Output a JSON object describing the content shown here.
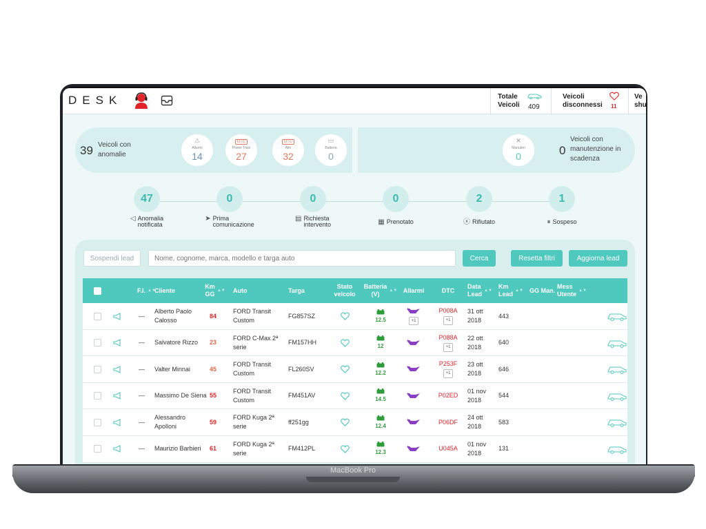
{
  "device_label": "MacBook Pro",
  "app": {
    "logo": "DESK"
  },
  "header_stats": [
    {
      "label_line1": "Totale",
      "label_line2": "Veicoli",
      "value": "409",
      "icon": "car-icon"
    },
    {
      "label_line1": "Veicoli",
      "label_line2": "disconnessi",
      "value": "11",
      "icon": "heart-icon"
    },
    {
      "label_line1": "Ve",
      "label_line2": "shu",
      "value": ""
    }
  ],
  "summary_left": {
    "count": "39",
    "label_line1": "Veicoli con",
    "label_line2": "anomalie",
    "circles": [
      {
        "label": "Allarmi",
        "value": "14",
        "icon": "warning-icon",
        "color": "#6b8fbf"
      },
      {
        "label": "Power Train",
        "value": "27",
        "icon": "dtc-icon",
        "icon_text": "DTC",
        "color": "#e07a5f"
      },
      {
        "label": "Altri",
        "value": "32",
        "icon": "dtc-icon",
        "icon_text": "DTC",
        "color": "#e07a5f"
      },
      {
        "label": "Batteria",
        "value": "0",
        "icon": "battery-icon",
        "color": "#8aa"
      }
    ]
  },
  "summary_right": {
    "count": "0",
    "label_line1": "Veicoli con",
    "label_line2": "manutenzione in",
    "label_line3": "scadenza",
    "circle": {
      "label": "Manuten",
      "value": "0",
      "icon": "wrench-icon"
    }
  },
  "workflow": [
    {
      "value": "47",
      "label_line1": "Anomalia",
      "label_line2": "notificata",
      "icon": "megaphone-icon"
    },
    {
      "value": "0",
      "label_line1": "Prima",
      "label_line2": "comunicazione",
      "icon": "paper-plane-icon"
    },
    {
      "value": "0",
      "label_line1": "Richiesta",
      "label_line2": "intervento",
      "icon": "calendar-icon"
    },
    {
      "value": "0",
      "label_line1": "Prenotato",
      "label_line2": "",
      "icon": "calendar-grid-icon"
    },
    {
      "value": "2",
      "label_line1": "Rifiutato",
      "label_line2": "",
      "icon": "x-circle-icon"
    },
    {
      "value": "1",
      "label_line1": "Sospeso",
      "label_line2": "",
      "icon": "pause-circle-icon"
    }
  ],
  "toolbar": {
    "suspend_label": "Sospendi lead",
    "search_placeholder": "Nome, cognome, marca, modello e targa auto",
    "search_button": "Cerca",
    "reset_button": "Resetta filtri",
    "update_button": "Aggiorna lead"
  },
  "table": {
    "headers": {
      "fi": "F.I.",
      "cliente": "Cliente",
      "km_gg_1": "Km",
      "km_gg_2": "GG",
      "auto": "Auto",
      "targa": "Targa",
      "stato_1": "Stato",
      "stato_2": "veicolo",
      "batteria_1": "Batteria",
      "batteria_2": "(V)",
      "allarmi": "Allarmi",
      "dtc": "DTC",
      "data_lead_1": "Data",
      "data_lead_2": "Lead",
      "km_lead_1": "Km",
      "km_lead_2": "Lead",
      "gg_man": "GG Man.",
      "mess_1": "Mess",
      "mess_2": "Utente"
    },
    "rows": [
      {
        "fi": "—",
        "cliente_1": "Alberto Paolo",
        "cliente_2": "Calosso",
        "km_gg": "84",
        "auto_1": "FORD Transit",
        "auto_2": "Custom",
        "targa": "FG857SZ",
        "batteria": "12.5",
        "dtc": "P008A",
        "dtc_extra": "+1",
        "allarmi_extra": "+1",
        "data_1": "31 ott",
        "data_2": "2018",
        "km_lead": "443"
      },
      {
        "fi": "—",
        "cliente_1": "Salvatore Rizzo",
        "cliente_2": "",
        "km_gg": "23",
        "auto_1": "FORD C-Max 2ª",
        "auto_2": "serie",
        "targa": "FM157HH",
        "batteria": "12",
        "dtc": "P088A",
        "dtc_extra": "+1",
        "allarmi_extra": "",
        "data_1": "22 ott",
        "data_2": "2018",
        "km_lead": "640"
      },
      {
        "fi": "—",
        "cliente_1": "Valter Minnai",
        "cliente_2": "",
        "km_gg": "45",
        "auto_1": "FORD Transit",
        "auto_2": "Custom",
        "targa": "FL260SV",
        "batteria": "12.2",
        "dtc": "P253F",
        "dtc_extra": "+1",
        "allarmi_extra": "",
        "data_1": "23 ott",
        "data_2": "2018",
        "km_lead": "646"
      },
      {
        "fi": "—",
        "cliente_1": "Massimo De Siena",
        "cliente_2": "",
        "km_gg": "55",
        "auto_1": "FORD Transit",
        "auto_2": "Custom",
        "targa": "FM451AV",
        "batteria": "14.5",
        "dtc": "P02ED",
        "dtc_extra": "",
        "allarmi_extra": "",
        "data_1": "01 nov",
        "data_2": "2018",
        "km_lead": "544"
      },
      {
        "fi": "—",
        "cliente_1": "Alessandro",
        "cliente_2": "Apolloni",
        "km_gg": "59",
        "auto_1": "FORD Kuga 2ª",
        "auto_2": "serie",
        "targa": "ff251gg",
        "batteria": "12.4",
        "dtc": "P06DF",
        "dtc_extra": "",
        "allarmi_extra": "",
        "data_1": "24 ott",
        "data_2": "2018",
        "km_lead": "583"
      },
      {
        "fi": "—",
        "cliente_1": "Maurizio Barbieri",
        "cliente_2": "",
        "km_gg": "61",
        "auto_1": "FORD Kuga 2ª",
        "auto_2": "serie",
        "targa": "FM412PL",
        "batteria": "12.3",
        "dtc": "U045A",
        "dtc_extra": "",
        "allarmi_extra": "",
        "data_1": "01 nov",
        "data_2": "2018",
        "km_lead": "131"
      }
    ]
  },
  "colors": {
    "teal": "#4fc8bd",
    "light_teal": "#d7efee",
    "red": "#e0242a",
    "green": "#2f9c3b",
    "purple": "#8a3fc2"
  }
}
